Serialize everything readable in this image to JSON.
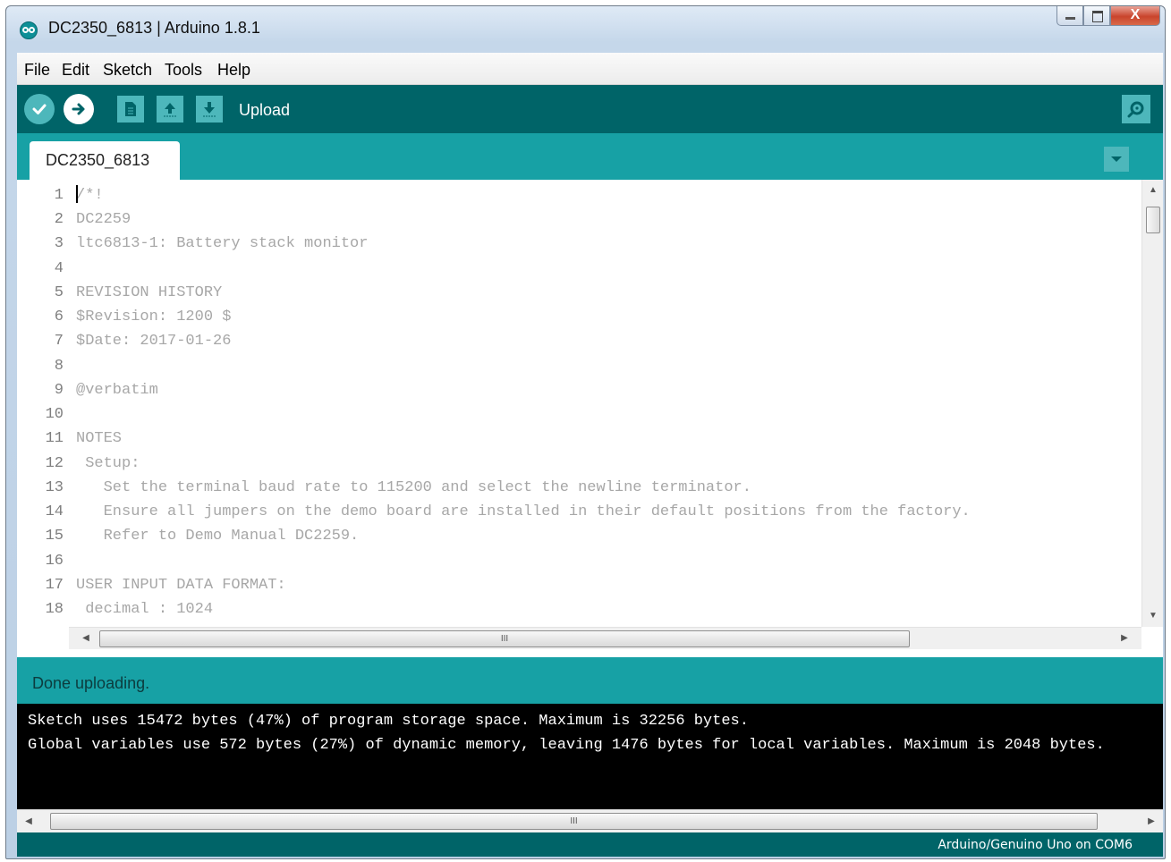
{
  "window": {
    "title": "DC2350_6813 | Arduino 1.8.1",
    "close_label": "X"
  },
  "menu": [
    "File",
    "Edit",
    "Sketch",
    "Tools",
    "Help"
  ],
  "toolbar": {
    "hover_label": "Upload",
    "buttons": [
      "verify-icon",
      "upload-icon",
      "new-icon",
      "open-icon",
      "save-icon",
      "serial-monitor-icon"
    ]
  },
  "tabs": [
    {
      "label": "DC2350_6813"
    }
  ],
  "editor": {
    "lines": [
      {
        "n": "1",
        "text": "/*!"
      },
      {
        "n": "2",
        "text": "DC2259"
      },
      {
        "n": "3",
        "text": "ltc6813-1: Battery stack monitor"
      },
      {
        "n": "4",
        "text": ""
      },
      {
        "n": "5",
        "text": "REVISION HISTORY"
      },
      {
        "n": "6",
        "text": "$Revision: 1200 $"
      },
      {
        "n": "7",
        "text": "$Date: 2017-01-26"
      },
      {
        "n": "8",
        "text": ""
      },
      {
        "n": "9",
        "text": "@verbatim"
      },
      {
        "n": "10",
        "text": ""
      },
      {
        "n": "11",
        "text": "NOTES"
      },
      {
        "n": "12",
        "text": " Setup:"
      },
      {
        "n": "13",
        "text": "   Set the terminal baud rate to 115200 and select the newline terminator."
      },
      {
        "n": "14",
        "text": "   Ensure all jumpers on the demo board are installed in their default positions from the factory."
      },
      {
        "n": "15",
        "text": "   Refer to Demo Manual DC2259."
      },
      {
        "n": "16",
        "text": ""
      },
      {
        "n": "17",
        "text": "USER INPUT DATA FORMAT:"
      },
      {
        "n": "18",
        "text": " decimal : 1024"
      }
    ],
    "scroll_grip": "III"
  },
  "status": {
    "message": "Done uploading."
  },
  "console": {
    "lines": [
      "Sketch uses 15472 bytes (47%) of program storage space. Maximum is 32256 bytes.",
      "Global variables use 572 bytes (27%) of dynamic memory, leaving 1476 bytes for local variables. Maximum is 2048 bytes."
    ],
    "scroll_grip": "III"
  },
  "footer": {
    "board": "Arduino/Genuino Uno on COM6"
  },
  "colors": {
    "toolbar": "#006468",
    "tabbar": "#17a1a5",
    "button": "#4db7bb",
    "code_text": "#a7a7a7",
    "console_bg": "#000000"
  }
}
